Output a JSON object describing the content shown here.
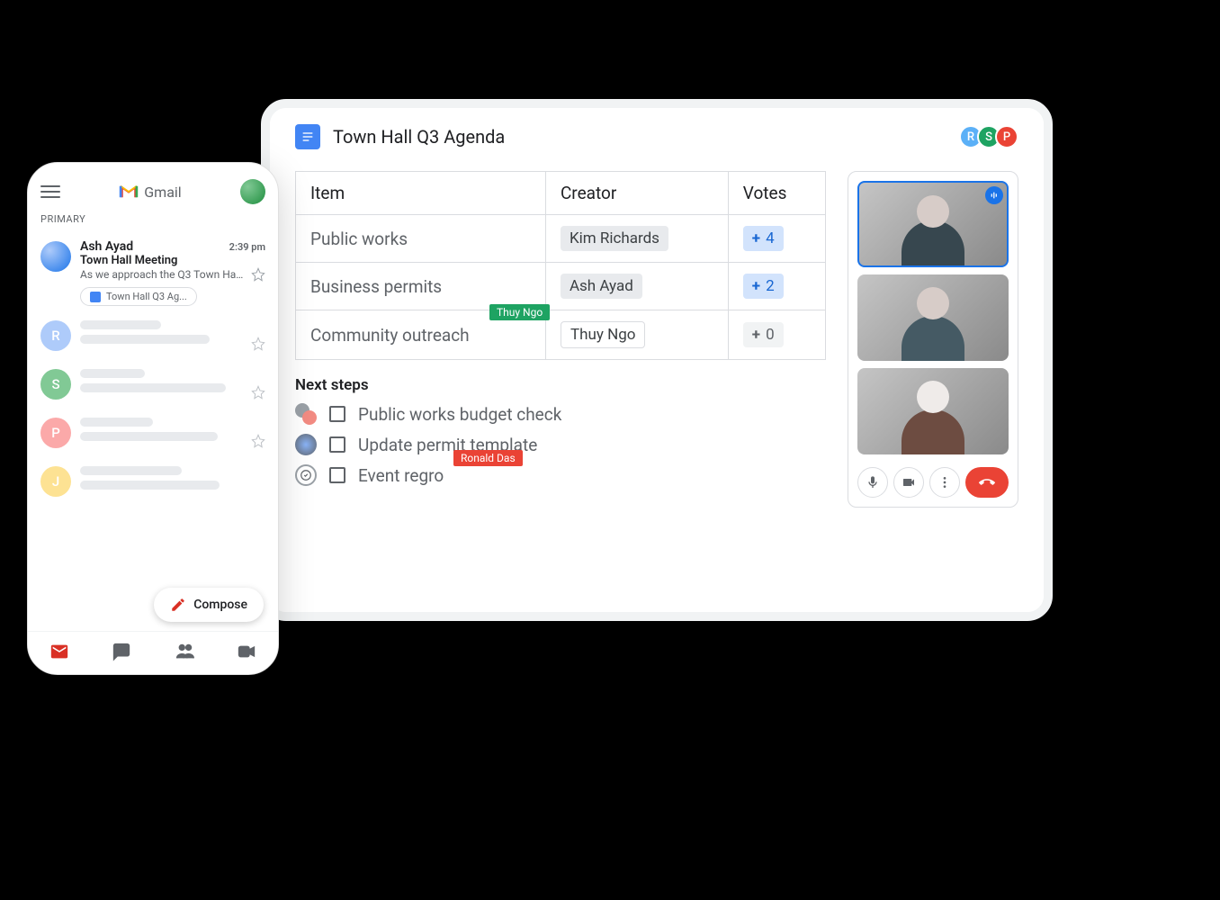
{
  "doc": {
    "title": "Town Hall Q3 Agenda",
    "collaborators": [
      {
        "initial": "R",
        "color": "blue"
      },
      {
        "initial": "S",
        "color": "green"
      },
      {
        "initial": "P",
        "color": "red"
      }
    ],
    "table": {
      "headers": {
        "item": "Item",
        "creator": "Creator",
        "votes": "Votes"
      },
      "rows": [
        {
          "item": "Public works",
          "creator": "Kim Richards",
          "votes": 4,
          "votes_active": true
        },
        {
          "item": "Business permits",
          "creator": "Ash Ayad",
          "votes": 2,
          "votes_active": true
        },
        {
          "item": "Community outreach",
          "creator": "Thuy Ngo",
          "votes": 0,
          "votes_active": false
        }
      ]
    },
    "cursor_tags": {
      "thuy": "Thuy Ngo",
      "ronald": "Ronald Das"
    },
    "next_steps": {
      "title": "Next steps",
      "items": [
        {
          "text": "Public works budget check"
        },
        {
          "text": "Update permit template"
        },
        {
          "text": "Event regro"
        }
      ]
    }
  },
  "meet": {
    "controls": {
      "mic": "mic",
      "cam": "camera",
      "more": "more",
      "hangup": "hangup"
    }
  },
  "gmail": {
    "brand": "Gmail",
    "primary_label": "PRIMARY",
    "featured_email": {
      "sender": "Ash Ayad",
      "time": "2:39 pm",
      "subject": "Town Hall Meeting",
      "preview": "As we approach the Q3 Town Ha...",
      "attachment": "Town Hall Q3 Ag..."
    },
    "skeleton_initials": [
      "R",
      "S",
      "P",
      "J"
    ],
    "compose": "Compose"
  }
}
